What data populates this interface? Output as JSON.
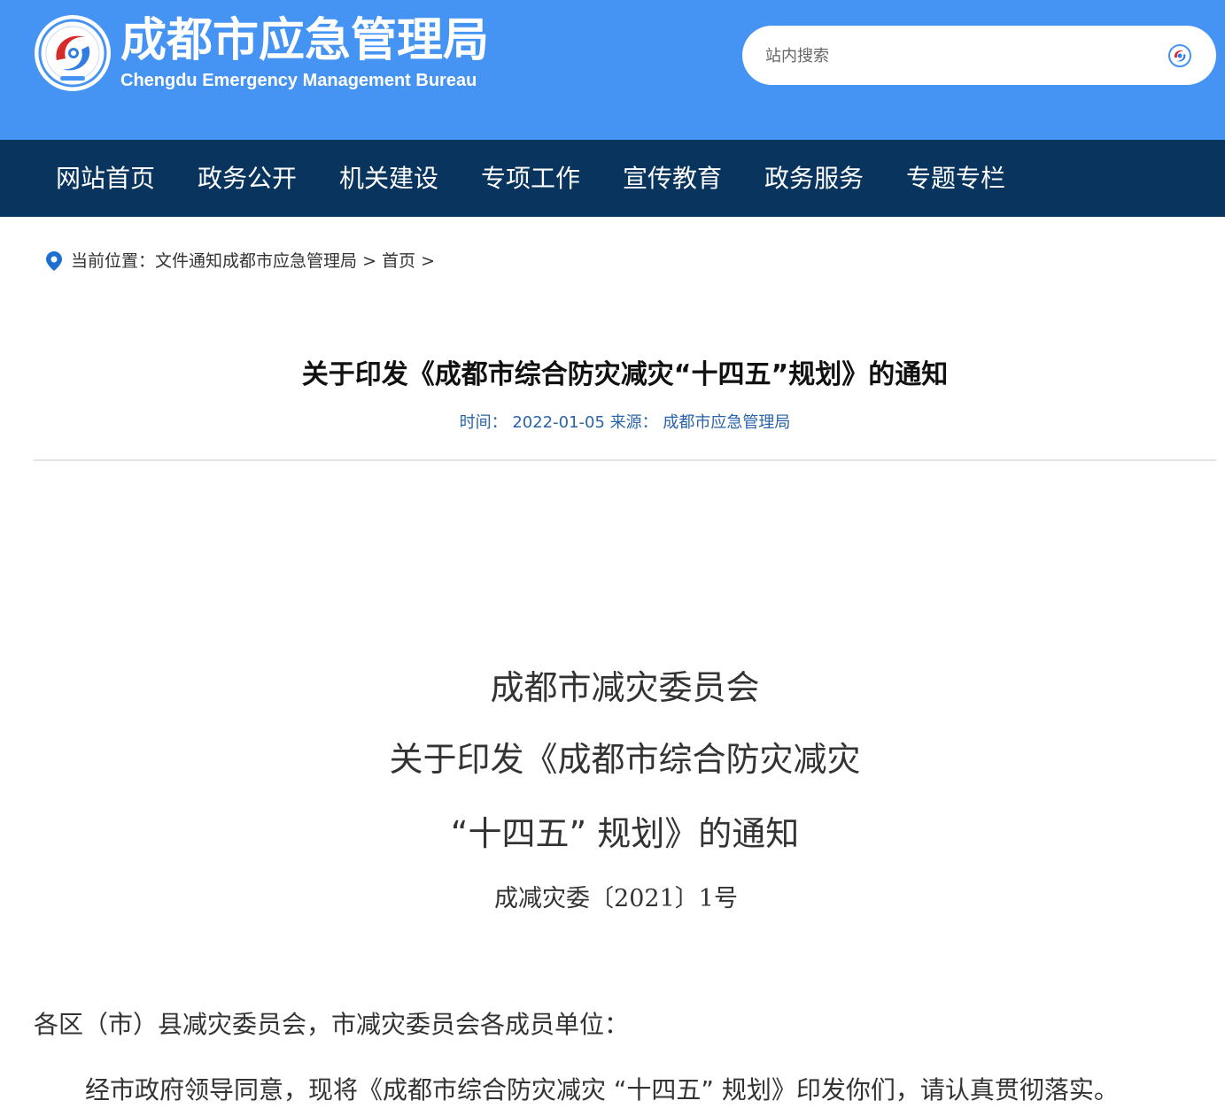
{
  "header": {
    "title": "成都市应急管理局",
    "subtitle": "Chengdu Emergency Management Bureau",
    "search_placeholder": "站内搜索",
    "brand_color": "#4593f2"
  },
  "nav": {
    "items": [
      "网站首页",
      "政务公开",
      "机关建设",
      "专项工作",
      "宣传教育",
      "政务服务",
      "专题专栏"
    ],
    "background_color": "#08345d"
  },
  "breadcrumb": {
    "prefix": "当前位置：",
    "crumb_1": "文件通知成都市应急管理局",
    "separator_1": " > ",
    "crumb_2": "首页",
    "separator_2": " >"
  },
  "article": {
    "title": "关于印发《成都市综合防灾减灾“十四五”规划》的通知",
    "meta": "时间： 2022-01-05 来源： 成都市应急管理局",
    "doc_title_lines": [
      "成都市减灾委员会",
      "关于印发《成都市综合防灾减灾",
      "“十四五” 规划》的通知"
    ],
    "doc_number": "成减灾委〔2021〕1号",
    "salutation": "各区（市）县减灾委员会，市减灾委员会各成员单位：",
    "paragraph_1": "经市政府领导同意，现将《成都市综合防灾减灾 “十四五” 规划》印发你们，请认真贯彻落实。"
  }
}
